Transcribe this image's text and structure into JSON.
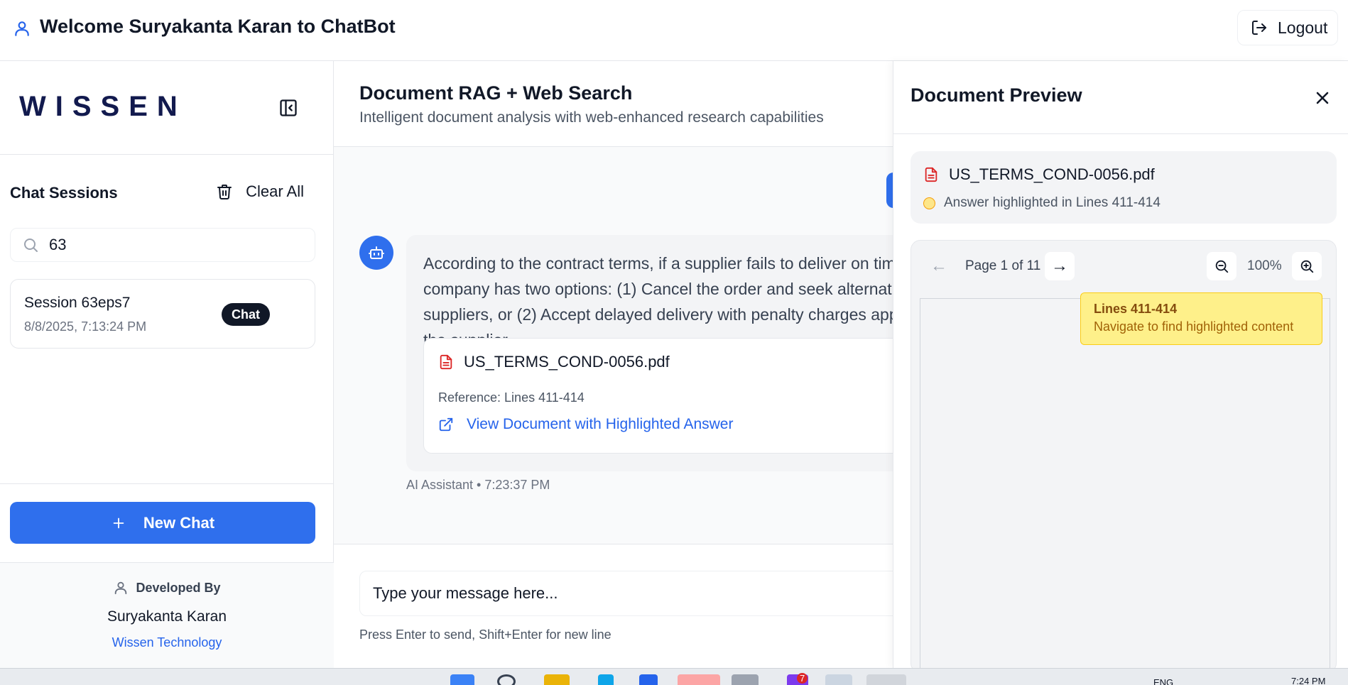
{
  "header": {
    "title": "Welcome Suryakanta Karan to ChatBot",
    "logout_label": "Logout"
  },
  "sidebar": {
    "logo": "WISSEN",
    "sessions_title": "Chat Sessions",
    "clear_all_label": "Clear All",
    "search_value": "63",
    "sessions": [
      {
        "name": "Session 63eps7",
        "date": "8/8/2025, 7:13:24 PM",
        "badge": "Chat"
      }
    ],
    "new_chat_label": "New Chat",
    "developed_by_label": "Developed By",
    "developer_name": "Suryakanta Karan",
    "company": "Wissen Technology"
  },
  "main": {
    "title": "Document RAG + Web Search",
    "subtitle": "Intelligent document analysis with web-enhanced research capabilities",
    "bot_message": "According to the contract terms, if a supplier fails to deliver on time, the company has two options: (1) Cancel the order and seek alternative suppliers, or (2) Accept delayed delivery with penalty charges applied to the supplier.",
    "source": {
      "file": "US_TERMS_COND-0056.pdf",
      "reference": "Reference: Lines 411-414",
      "link_label": "View Document with Highlighted Answer"
    },
    "message_meta": "AI Assistant • 7:23:37 PM",
    "input_placeholder": "Type your message here...",
    "input_hint": "Press Enter to send, Shift+Enter for new line"
  },
  "preview": {
    "title": "Document Preview",
    "file": "US_TERMS_COND-0056.pdf",
    "highlight_info": "Answer highlighted in Lines 411-414",
    "page_label": "Page 1 of 11",
    "zoom": "100%",
    "tooltip_title": "Lines 411-414",
    "tooltip_subtitle": "Navigate to find highlighted content"
  },
  "taskbar": {
    "lang": "ENG",
    "time": "7:24 PM",
    "notification_count": "7"
  },
  "colors": {
    "accent": "#2f6fed",
    "link": "#2563eb",
    "pdf_red": "#dc2626",
    "highlight": "#fef08a"
  }
}
